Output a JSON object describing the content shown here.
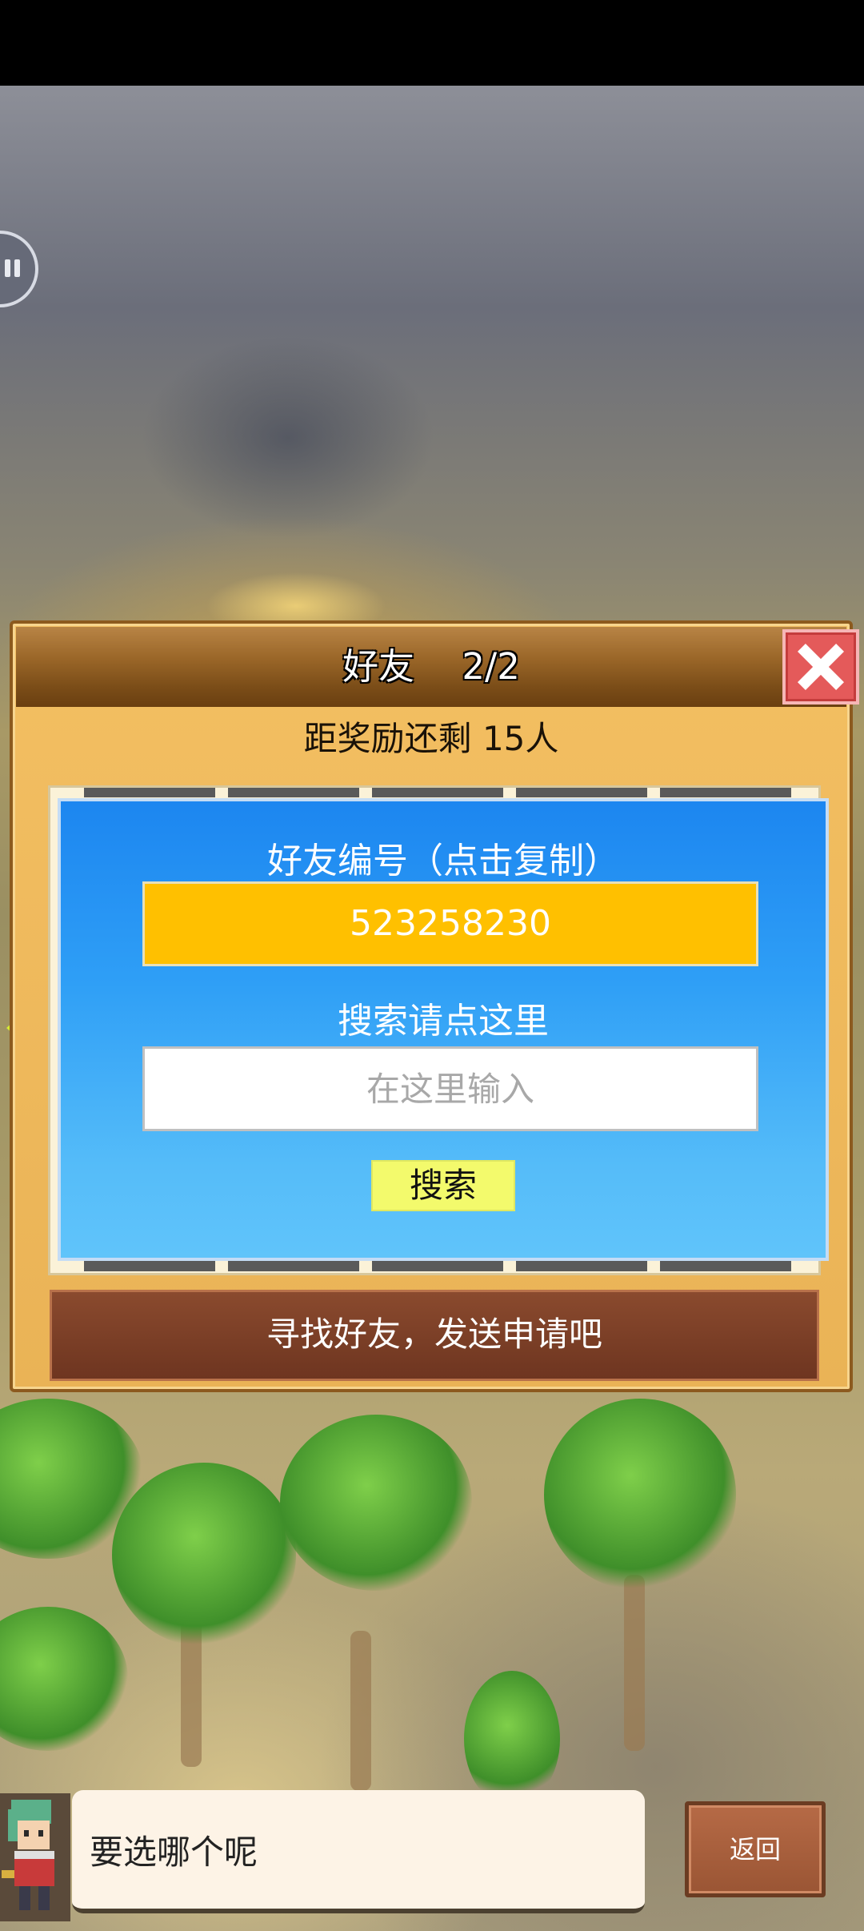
{
  "dialog": {
    "title": "好友　 2/2",
    "reward_text": "距奖励还剩 15人",
    "friend_id_label": "好友编号（点击复制）",
    "friend_id": "523258230",
    "search_label": "搜索请点这里",
    "search_placeholder": "在这里输入",
    "search_button": "搜索",
    "send_request_text": "寻找好友，发送申请吧"
  },
  "message_bar": {
    "text": "要选哪个呢",
    "back_button": "返回"
  },
  "icons": {
    "pause": "pause-icon",
    "close": "close-icon",
    "left_arrow": "arrow-left-icon",
    "right_arrow": "arrow-right-icon",
    "avatar": "character-avatar"
  },
  "colors": {
    "friend_id_box": "#ffc000",
    "search_button": "#f3fa6c",
    "close_button": "#e45a5a",
    "panel_blue": "#2f9ff6"
  }
}
